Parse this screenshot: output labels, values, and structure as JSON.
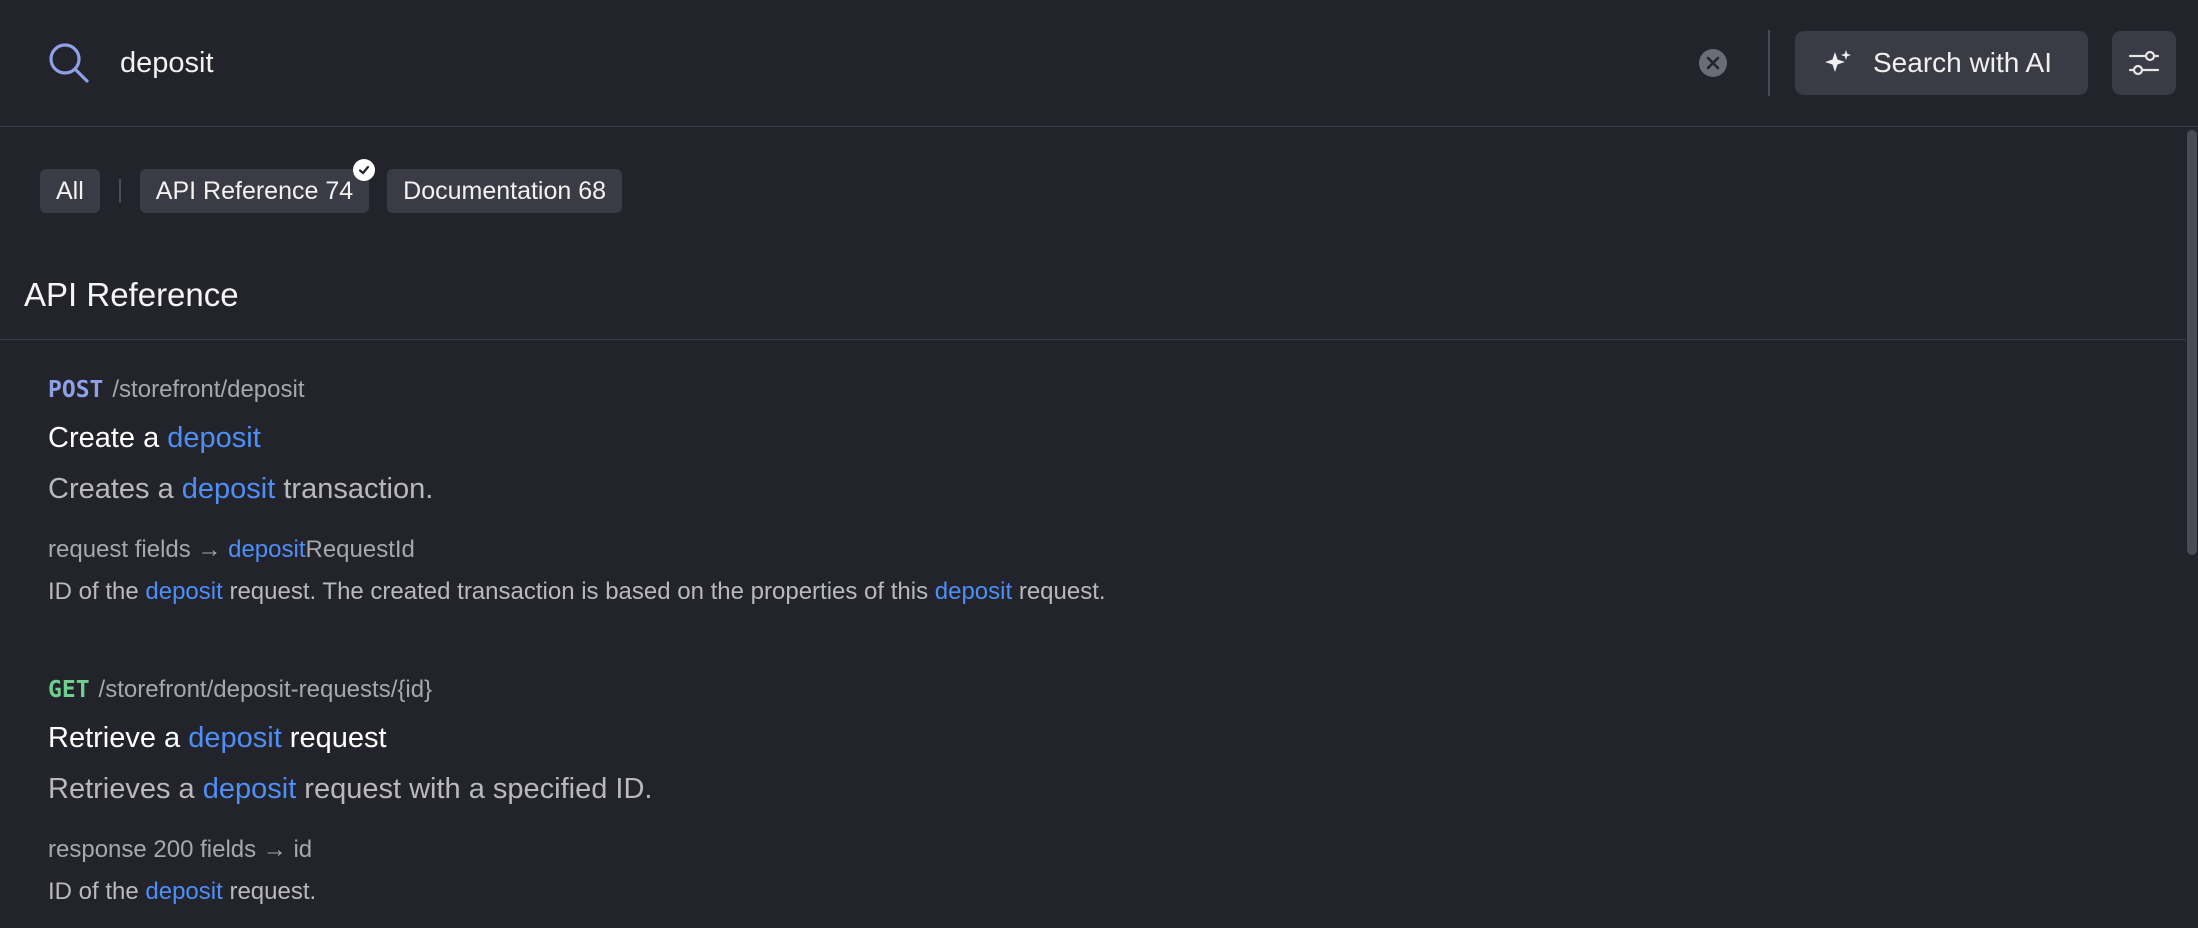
{
  "search": {
    "value": "deposit",
    "ai_button_label": "Search with AI"
  },
  "filters": [
    {
      "label": "All"
    },
    {
      "label": "API Reference 74"
    },
    {
      "label": "Documentation 68"
    }
  ],
  "section": {
    "title": "API Reference"
  },
  "results": [
    {
      "method": "POST",
      "path": "/storefront/deposit",
      "title": {
        "pre": "Create a ",
        "hl": "deposit",
        "post": ""
      },
      "desc": {
        "pre": "Creates a ",
        "hl": "deposit",
        "post": " transaction."
      },
      "field": {
        "pre": "request fields → ",
        "hl": "deposit",
        "post": "RequestId"
      },
      "field_desc": {
        "pre": "ID of the ",
        "hl": "deposit",
        "mid": " request. The created transaction is based on the properties of this ",
        "hl2": "deposit",
        "post": " request."
      }
    },
    {
      "method": "GET",
      "path": "/storefront/deposit-requests/{id}",
      "title": {
        "pre": "Retrieve a ",
        "hl": "deposit",
        "post": " request"
      },
      "desc": {
        "pre": "Retrieves a ",
        "hl": "deposit",
        "post": " request with a specified ID."
      },
      "field": {
        "pre": "response 200 fields → id"
      },
      "field_desc": {
        "pre": "ID of the ",
        "hl": "deposit",
        "post": " request."
      }
    }
  ],
  "colors": {
    "background": "#23242b",
    "highlight": "#4e8ef7",
    "post": "#8ea0e8",
    "get": "#6fcf8e"
  },
  "icons": [
    "search-icon",
    "clear-icon",
    "sparkle-icon",
    "sliders-icon",
    "check-icon"
  ]
}
